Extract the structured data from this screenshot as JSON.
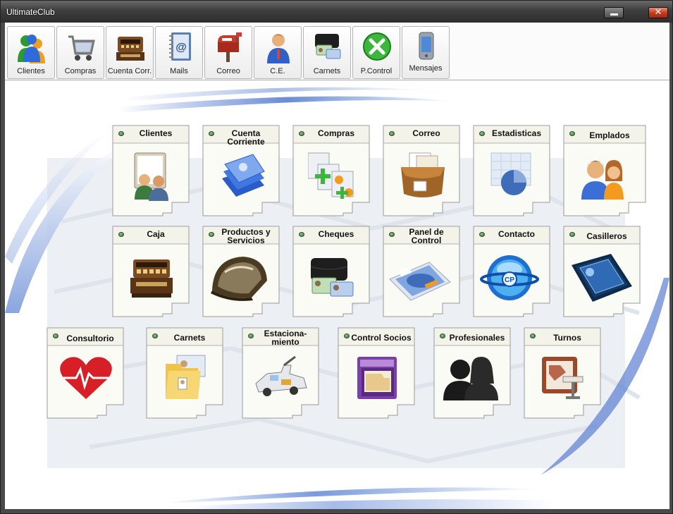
{
  "window": {
    "title": "UltimateClub"
  },
  "toolbar": {
    "items": [
      {
        "label": "Clientes",
        "icon": "clients-icon"
      },
      {
        "label": "Compras",
        "icon": "shopping-cart-icon"
      },
      {
        "label": "Cuenta Corr.",
        "icon": "cash-register-icon"
      },
      {
        "label": "Mails",
        "icon": "mail-book-icon"
      },
      {
        "label": "Correo",
        "icon": "mailbox-icon"
      },
      {
        "label": "C.E.",
        "icon": "thinking-person-icon"
      },
      {
        "label": "Carnets",
        "icon": "wallet-cards-icon"
      },
      {
        "label": "P.Control",
        "icon": "tools-icon"
      },
      {
        "label": "Mensajes",
        "icon": "phone-icon"
      }
    ]
  },
  "tiles": {
    "row1": [
      {
        "label": "Clientes",
        "icon": "clients-folder-icon"
      },
      {
        "label": "Cuenta Corriente",
        "icon": "accounts-stack-icon"
      },
      {
        "label": "Compras",
        "icon": "purchase-docs-icon"
      },
      {
        "label": "Correo",
        "icon": "mail-bag-icon"
      },
      {
        "label": "Estadisticas",
        "icon": "pie-chart-icon"
      },
      {
        "label": "Emplados",
        "icon": "employees-icon"
      }
    ],
    "row2": [
      {
        "label": "Caja",
        "icon": "cash-register-icon"
      },
      {
        "label": "Productos y Servicios",
        "icon": "helmet-icon"
      },
      {
        "label": "Cheques",
        "icon": "wallet-icon"
      },
      {
        "label": "Panel de Control",
        "icon": "control-panel-icon"
      },
      {
        "label": "Contacto",
        "icon": "contact-globe-icon"
      },
      {
        "label": "Casilleros",
        "icon": "lockers-icon"
      }
    ],
    "row3": [
      {
        "label": "Consultorio",
        "icon": "heart-pulse-icon"
      },
      {
        "label": "Carnets",
        "icon": "id-card-folder-icon"
      },
      {
        "label": "Estaciona-miento",
        "icon": "tow-truck-icon"
      },
      {
        "label": "Control Socios",
        "icon": "file-drawer-icon"
      },
      {
        "label": "Profesionales",
        "icon": "silhouettes-icon"
      },
      {
        "label": "Turnos",
        "icon": "schedule-board-icon"
      }
    ]
  }
}
